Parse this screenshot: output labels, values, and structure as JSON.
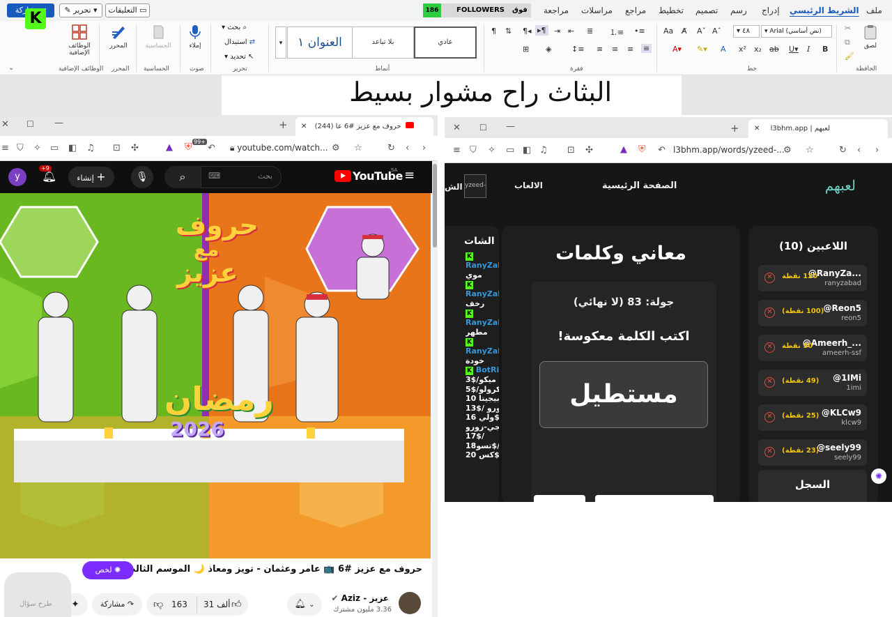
{
  "word": {
    "share_label": "مشاركة",
    "edit_label": "تحرير",
    "comments_label": "التعليقات",
    "followers_count": "186",
    "followers_label": "FOLLOWERS",
    "followers_extra": "فوق",
    "tabs": [
      "ملف",
      "الشريط الرئيسي",
      "إدراج",
      "رسم",
      "تصميم",
      "تخطيط",
      "مراجع",
      "مراسلات",
      "مراجعة"
    ],
    "ribbon": {
      "addins": "الوظائف الإضافية",
      "addins_group": "الوظائف الإضافية",
      "editor": "المحرر",
      "editor_group": "المحرر",
      "sensitivity": "الحساسية",
      "sensitivity_group": "الحساسية",
      "dictate": "إملاء",
      "voice_group": "صوت",
      "find": "بحث",
      "replace": "استبدال",
      "select": "تحديد",
      "editing_group": "تحرير",
      "styles_group": "أنماط",
      "style_heading1": "العنوان ١",
      "style_nospacing": "بلا تباعد",
      "style_normal": "عادي",
      "paragraph_group": "فقرة",
      "font_group": "خط",
      "font_name": "Arial (نص أساسي)",
      "font_size": "٤٨",
      "clipboard_group": "الحافظة",
      "paste": "لصق"
    },
    "document_text": "البثاث راح مشوار بسيط"
  },
  "youtube_window": {
    "tab_title": "(244) حروف مع عزيز #6 عا",
    "url": "youtube.com/watch...",
    "search_placeholder": "بحث",
    "create_label": "إنشاء",
    "notif_count": "+9",
    "avatar_letter": "y",
    "logo_text": "YouTube",
    "logo_region": "SA",
    "video_title": "حروف مع عزيز #6 📺 عامر وعثمان - تويز ومعاذ 🌙 الموسم الثالث",
    "summarize_label": "لخص",
    "channel_name": "عزيز - Aziz",
    "subscribers": "3.36 مليون مشترك",
    "likes": "31 ألف",
    "dislikes": "163",
    "share_label": "مشاركة",
    "ask_label": "طرح سؤال",
    "ext_badge": "99+"
  },
  "l3bhm_window": {
    "tab_title": "l3bhm.app | لعبهم",
    "url": "l3bhm.app/words/yzeed-...",
    "logo": "لعبهم",
    "nav_home": "الصفحة الرئيسية",
    "nav_games": "الالعاب",
    "nav_img_alt": "yzeed-...",
    "nav_cut": "الش",
    "players_title": "اللاعبين (10)",
    "players": [
      {
        "name": "@RanyZa...",
        "user": "ranyzabad",
        "points": "120 نقطة"
      },
      {
        "name": "@Reon5",
        "user": "reon5",
        "points": "(100 نقطة)"
      },
      {
        "name": "@Ameerh_...",
        "user": "ameerh-ssf",
        "points": "50 نقطة"
      },
      {
        "name": "@1IMi",
        "user": "1imi",
        "points": "(49 نقطة)"
      },
      {
        "name": "@KLCw9",
        "user": "klcw9",
        "points": "(25 نقطة)"
      },
      {
        "name": "@seely99",
        "user": "seely99",
        "points": "(23 نقطة)"
      }
    ],
    "log_title": "السجل",
    "game_title": "معاني وكلمات",
    "round": "جولة: 83 (لا نهائي)",
    "instruction": "اكتب الكلمة معكوسة!",
    "word": "مستطيل",
    "chat_title": "الشات",
    "chat": [
      {
        "kind": "user",
        "text": "RanyZab"
      },
      {
        "kind": "msg",
        "text": "موي"
      },
      {
        "kind": "user",
        "text": "RanyZab"
      },
      {
        "kind": "msg",
        "text": "رخف"
      },
      {
        "kind": "user",
        "text": "RanyZab"
      },
      {
        "kind": "msg",
        "text": "مطهر"
      },
      {
        "kind": "user",
        "text": "RanyZab"
      },
      {
        "kind": "msg",
        "text": "خودة"
      },
      {
        "kind": "bot",
        "text": "BotRi"
      },
      {
        "kind": "msg",
        "text": "3$/ميكو"
      },
      {
        "kind": "msg",
        "text": "5$/كرولو"
      },
      {
        "kind": "msg",
        "text": "بيجيتا 10"
      },
      {
        "kind": "msg",
        "text": "13$/ زورو"
      },
      {
        "kind": "msg",
        "text": "ولي 16$ /"
      },
      {
        "kind": "msg",
        "text": "انجي-زورو"
      },
      {
        "kind": "msg",
        "text": "17$/"
      },
      {
        "kind": "msg",
        "text": "تسو18$/"
      },
      {
        "kind": "msg",
        "text": "كس 20$/"
      }
    ]
  },
  "video_overlay": {
    "show_title_line1": "حروف",
    "show_title_line2": "مع",
    "show_title_line3": "عزيز",
    "ramadan": "رمضان",
    "year": "2026"
  }
}
